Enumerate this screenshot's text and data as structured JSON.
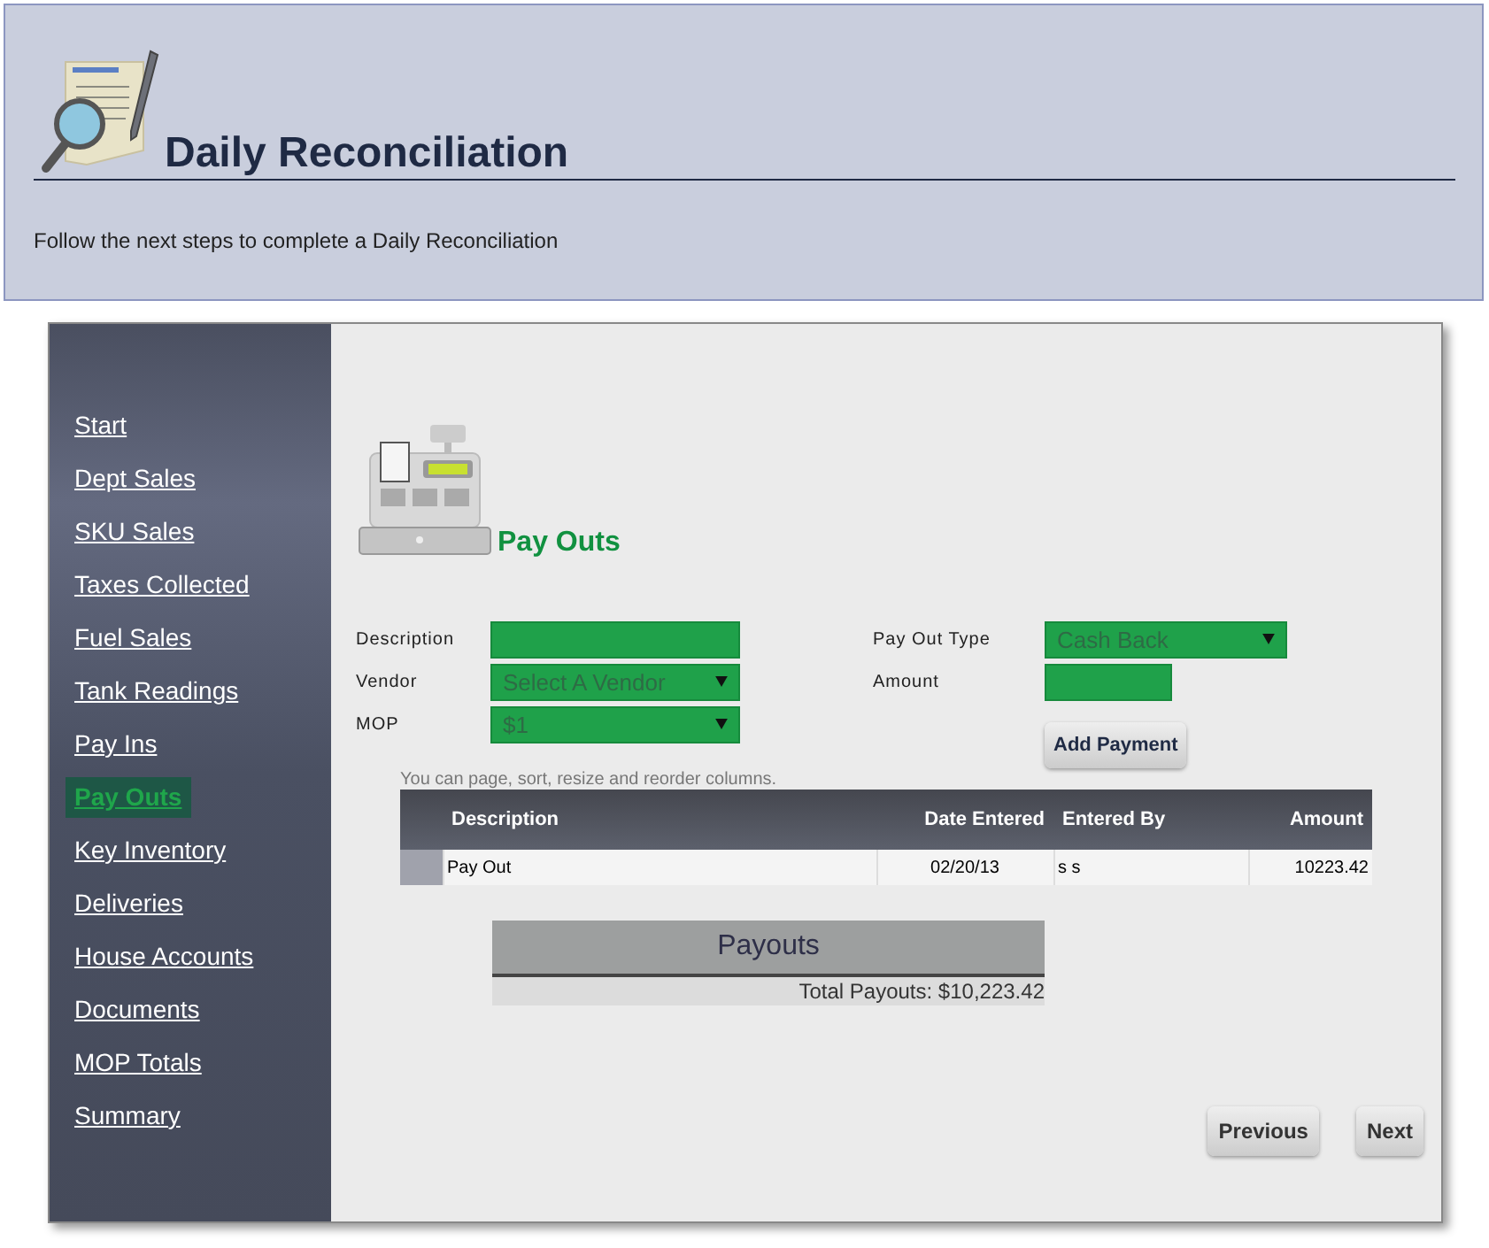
{
  "header": {
    "title": "Daily Reconciliation",
    "subtitle": "Follow the next steps to complete a Daily Reconciliation"
  },
  "sidebar": {
    "items": [
      {
        "label": "Start",
        "selected": false
      },
      {
        "label": "Dept Sales",
        "selected": false
      },
      {
        "label": "SKU Sales",
        "selected": false
      },
      {
        "label": "Taxes Collected",
        "selected": false
      },
      {
        "label": "Fuel Sales",
        "selected": false
      },
      {
        "label": "Tank Readings",
        "selected": false
      },
      {
        "label": "Pay Ins",
        "selected": false
      },
      {
        "label": "Pay Outs",
        "selected": true
      },
      {
        "label": "Key Inventory",
        "selected": false
      },
      {
        "label": "Deliveries",
        "selected": false
      },
      {
        "label": "House Accounts",
        "selected": false
      },
      {
        "label": "Documents",
        "selected": false
      },
      {
        "label": "MOP Totals",
        "selected": false
      },
      {
        "label": "Summary",
        "selected": false
      }
    ]
  },
  "page": {
    "title": "Pay Outs"
  },
  "form": {
    "left": [
      {
        "label": "Description",
        "kind": "text"
      },
      {
        "label": "Vendor",
        "kind": "select",
        "value": "Select A Vendor"
      },
      {
        "label": "MOP",
        "kind": "select",
        "value": "$1"
      }
    ],
    "right": [
      {
        "label": "Pay Out Type",
        "kind": "select",
        "value": "Cash Back"
      },
      {
        "label": "Amount",
        "kind": "text"
      }
    ],
    "button": "Add Payment"
  },
  "table": {
    "hint": "You can page, sort, resize and reorder columns.",
    "columns": [
      "Description",
      "Date Entered",
      "Entered By",
      "Amount"
    ],
    "rows": [
      [
        "Pay Out",
        "02/20/13",
        "s s",
        "10223.42"
      ]
    ]
  },
  "summary": {
    "title": "Payouts",
    "total": "Total Payouts: $10,223.42"
  },
  "buttons": [
    "Previous",
    "Next"
  ]
}
